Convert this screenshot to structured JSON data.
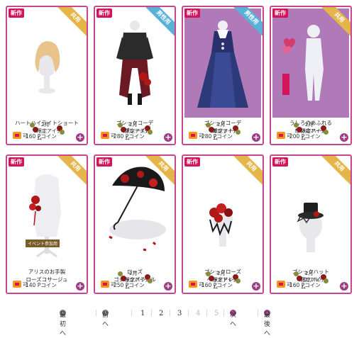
{
  "badges": {
    "new": "新作",
    "shared": "共用",
    "male": "男性用",
    "ka": "可",
    "month": "2月",
    "limited": "限定アイテム",
    "event": "イベント参加用"
  },
  "items": [
    {
      "name": "ハートハイライトショート",
      "price": "160 Pコイン",
      "ribbon": "shared"
    },
    {
      "name": "ゴシックコーデ\n（ブレーズ）",
      "price": "280 Pコイン",
      "ribbon": "male"
    },
    {
      "name": "ゴシックコーデ\n（エジット）",
      "price": "280 Pコイン",
      "ribbon": "male"
    },
    {
      "name": "うしろのあふれる\n想いのハート",
      "price": "200 Pコイン",
      "ribbon": "shared"
    },
    {
      "name": "アリスのお手製\nローズコサージュ",
      "price": "140 Pコイン",
      "ribbon": "shared"
    },
    {
      "name": "ローズ\nゴシックパラソル",
      "price": "250 Pコイン",
      "ribbon": "shared"
    },
    {
      "name": "ゴシックローズ\nヘッドドレス",
      "price": "160 Pコイン",
      "ribbon": "shared"
    },
    {
      "name": "ゴシックハット\n（フリル）",
      "price": "160 Pコイン",
      "ribbon": "shared"
    }
  ],
  "pager": {
    "first": "最初へ",
    "prev": "前へ",
    "pages": [
      "1",
      "2",
      "3",
      "4",
      "5"
    ],
    "next": "次へ",
    "last": "最後へ",
    "sep": "|"
  },
  "colors": {
    "border": "#c9458f",
    "new": "#d4145a",
    "shared": "#e5b54a",
    "male": "#5ab1d8",
    "plus": "#9c3d86"
  },
  "icons": {
    "plus": "+",
    "arrow_left": "‹",
    "arrow_right": "›"
  }
}
